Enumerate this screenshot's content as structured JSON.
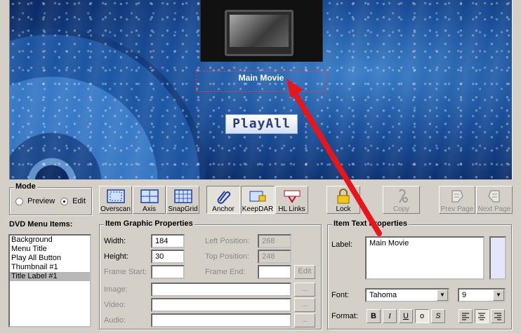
{
  "preview": {
    "title_label": "Main Movie",
    "playall_label": "PlayAll"
  },
  "mode": {
    "title": "Mode",
    "options": [
      "Preview",
      "Edit"
    ],
    "selected": "Edit"
  },
  "toolbar": {
    "overscan": "Overscan",
    "axis": "Axis",
    "snapgrid": "SnapGrid",
    "anchor": "Anchor",
    "keepdar": "KeepDAR",
    "hllinks": "HL Links",
    "lock": "Lock",
    "copy": "Copy",
    "prev_page": "Prev Page",
    "next_page": "Next Page"
  },
  "menu_items": {
    "title": "DVD Menu Items:",
    "items": [
      "Background",
      "Menu Title",
      "Play All Button",
      "Thumbnail #1",
      "Title Label #1"
    ],
    "selected_index": 4
  },
  "graphic": {
    "title": "Item Graphic Properties",
    "width_label": "Width:",
    "width_value": "184",
    "height_label": "Height:",
    "height_value": "30",
    "left_label": "Left Position:",
    "left_value": "268",
    "top_label": "Top Position:",
    "top_value": "248",
    "frame_start_label": "Frame Start:",
    "frame_end_label": "Frame End:",
    "edit_button": "Edit",
    "image_label": "Image:",
    "video_label": "Video:",
    "audio_label": "Audio:",
    "browse": "..."
  },
  "text_props": {
    "title": "Item Text Properties",
    "label_label": "Label:",
    "label_value": "Main Movie",
    "font_label": "Font:",
    "font_value": "Tahoma",
    "size_value": "9",
    "format_label": "Format:",
    "bold": "B",
    "italic": "I",
    "underline": "U",
    "outline": "o",
    "shadow": "S"
  },
  "colors": {
    "selection_dashed": "#ff3333",
    "arrow": "#e8151b",
    "window_bg": "#d4d0c8"
  }
}
